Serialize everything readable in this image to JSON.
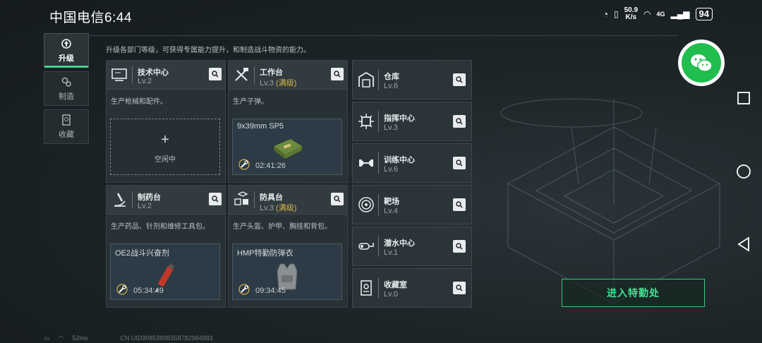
{
  "status_bar": {
    "carrier": "中国电信",
    "time": "6:44",
    "speed_value": "50.9",
    "speed_unit": "K/s",
    "network": "4G",
    "battery": "94"
  },
  "sidebar": [
    {
      "label": "升级",
      "icon": "upgrade-icon",
      "active": true
    },
    {
      "label": "制造",
      "icon": "gears-icon",
      "active": false
    },
    {
      "label": "收藏",
      "icon": "collection-icon",
      "active": false
    }
  ],
  "description": "升级各部门等级，可获得专属能力提升，和制造战斗物资的能力。",
  "cards": {
    "tech": {
      "name": "技术中心",
      "level": "Lv.2",
      "desc": "生产枪械和配件。",
      "slot_plus": "+",
      "slot_label": "空闲中"
    },
    "workbench": {
      "name": "工作台",
      "level": "Lv.3",
      "max": "(满级)",
      "desc": "生产子弹。",
      "item": "9x39mm SP5",
      "timer": "02:41:26"
    },
    "pharmacy": {
      "name": "制药台",
      "level": "Lv.2",
      "desc": "生产药品、针剂和维修工具包。",
      "item": "OE2战斗兴奋剂",
      "timer": "05:34:49"
    },
    "armor": {
      "name": "防具台",
      "level": "Lv.3",
      "max": "(满级)",
      "desc": "生产头盔、护甲、胸挂和背包。",
      "item": "HMP特勤防弹衣",
      "timer": "09:34:45"
    }
  },
  "right_list": [
    {
      "name": "仓库",
      "level": "Lv.6",
      "icon": "warehouse-icon"
    },
    {
      "name": "指挥中心",
      "level": "Lv.3",
      "icon": "command-center-icon"
    },
    {
      "name": "训练中心",
      "level": "Lv.6",
      "icon": "dumbbell-icon"
    },
    {
      "name": "靶场",
      "level": "Lv.4",
      "icon": "target-icon"
    },
    {
      "name": "潜水中心",
      "level": "Lv.1",
      "icon": "diving-icon"
    },
    {
      "name": "收藏室",
      "level": "Lv.0",
      "icon": "collection-room-icon"
    }
  ],
  "enter_button": "进入特勤处",
  "footer": {
    "ping": "52ms",
    "uid": "CN UID90853898358782984883"
  },
  "colors": {
    "accent": "#3fd38a",
    "max_level": "#d6b24a",
    "wechat": "#1fbe4e"
  }
}
